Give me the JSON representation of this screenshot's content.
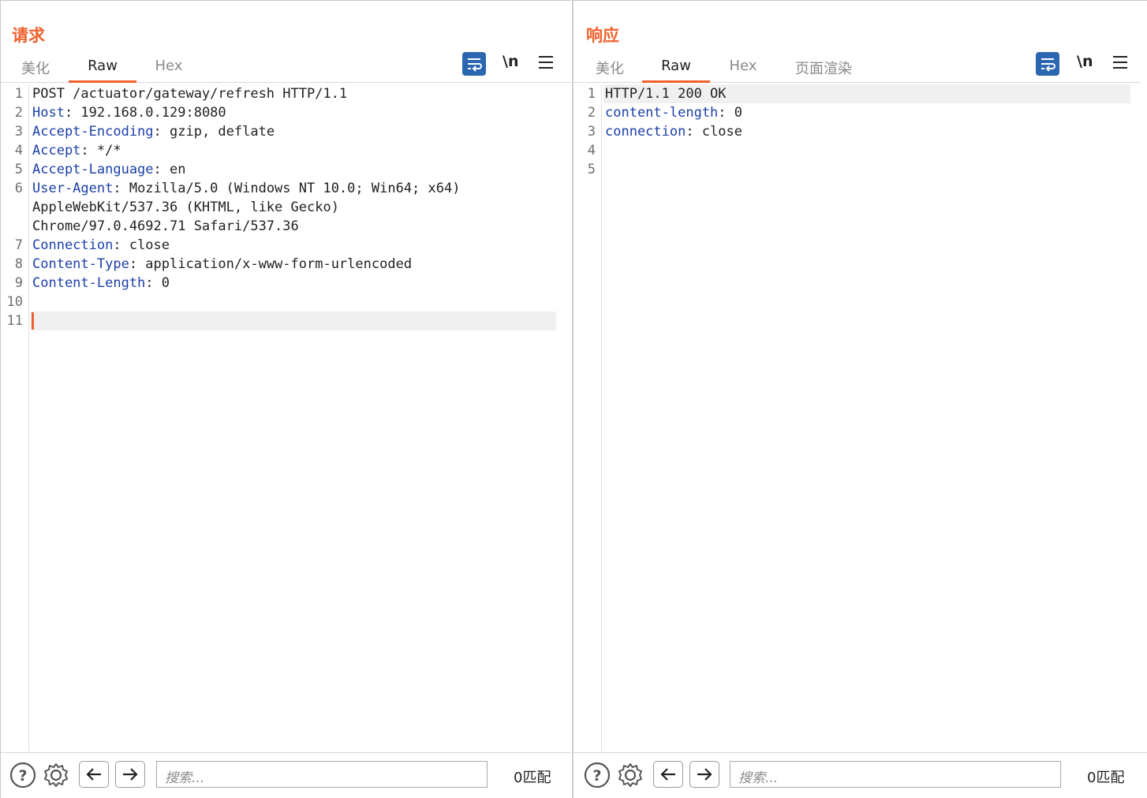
{
  "layout_toggle": {
    "options": [
      "side-by-side",
      "stacked",
      "single"
    ],
    "selected": "side-by-side",
    "accent_color": "#2b66b0"
  },
  "request": {
    "title": "请求",
    "tabs": [
      "美化",
      "Raw",
      "Hex"
    ],
    "active_tab": "Raw",
    "toolbar": {
      "newline_label": "\\n"
    },
    "lines": [
      {
        "num": "1",
        "name": "",
        "value": "POST /actuator/gateway/refresh HTTP/1.1"
      },
      {
        "num": "2",
        "name": "Host",
        "value": ": 192.168.0.129:8080"
      },
      {
        "num": "3",
        "name": "Accept-Encoding",
        "value": ": gzip, deflate"
      },
      {
        "num": "4",
        "name": "Accept",
        "value": ": */*"
      },
      {
        "num": "5",
        "name": "Accept-Language",
        "value": ": en"
      },
      {
        "num": "6",
        "name": "User-Agent",
        "value": ": Mozilla/5.0 (Windows NT 10.0; Win64; x64)"
      },
      {
        "num": "",
        "name": "",
        "value": "AppleWebKit/537.36 (KHTML, like Gecko)"
      },
      {
        "num": "",
        "name": "",
        "value": "Chrome/97.0.4692.71 Safari/537.36"
      },
      {
        "num": "7",
        "name": "Connection",
        "value": ": close"
      },
      {
        "num": "8",
        "name": "Content-Type",
        "value": ": application/x-www-form-urlencoded"
      },
      {
        "num": "9",
        "name": "Content-Length",
        "value": ": 0"
      },
      {
        "num": "10",
        "name": "",
        "value": ""
      },
      {
        "num": "11",
        "name": "",
        "value": ""
      }
    ],
    "search_placeholder": "搜索...",
    "matches": "0匹配"
  },
  "response": {
    "title": "响应",
    "tabs": [
      "美化",
      "Raw",
      "Hex",
      "页面渲染"
    ],
    "active_tab": "Raw",
    "toolbar": {
      "newline_label": "\\n"
    },
    "lines": [
      {
        "num": "1",
        "name": "",
        "value": "HTTP/1.1 200 OK"
      },
      {
        "num": "2",
        "name": "content-length",
        "value": ": 0"
      },
      {
        "num": "3",
        "name": "connection",
        "value": ": close"
      },
      {
        "num": "4",
        "name": "",
        "value": ""
      },
      {
        "num": "5",
        "name": "",
        "value": ""
      }
    ],
    "search_placeholder": "搜索...",
    "matches": "0匹配"
  },
  "colors": {
    "accent": "#f0612d",
    "header_name": "#1c3fa8",
    "primary": "#2b66b0"
  }
}
